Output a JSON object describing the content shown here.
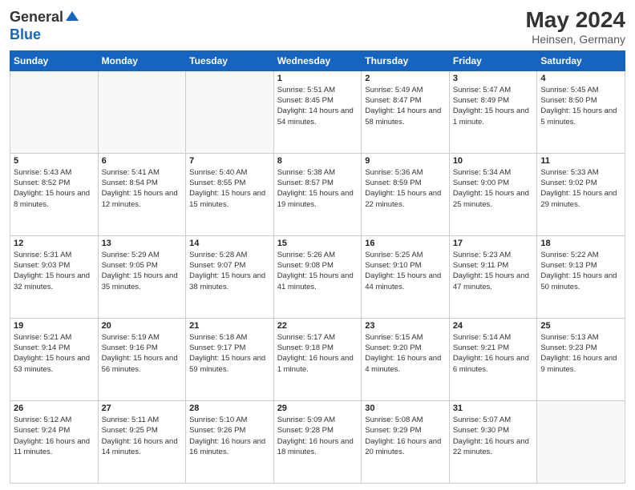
{
  "header": {
    "logo_general": "General",
    "logo_blue": "Blue",
    "month_title": "May 2024",
    "location": "Heinsen, Germany"
  },
  "weekdays": [
    "Sunday",
    "Monday",
    "Tuesday",
    "Wednesday",
    "Thursday",
    "Friday",
    "Saturday"
  ],
  "weeks": [
    [
      {
        "day": "",
        "sunrise": "",
        "sunset": "",
        "daylight": ""
      },
      {
        "day": "",
        "sunrise": "",
        "sunset": "",
        "daylight": ""
      },
      {
        "day": "",
        "sunrise": "",
        "sunset": "",
        "daylight": ""
      },
      {
        "day": "1",
        "sunrise": "Sunrise: 5:51 AM",
        "sunset": "Sunset: 8:45 PM",
        "daylight": "Daylight: 14 hours and 54 minutes."
      },
      {
        "day": "2",
        "sunrise": "Sunrise: 5:49 AM",
        "sunset": "Sunset: 8:47 PM",
        "daylight": "Daylight: 14 hours and 58 minutes."
      },
      {
        "day": "3",
        "sunrise": "Sunrise: 5:47 AM",
        "sunset": "Sunset: 8:49 PM",
        "daylight": "Daylight: 15 hours and 1 minute."
      },
      {
        "day": "4",
        "sunrise": "Sunrise: 5:45 AM",
        "sunset": "Sunset: 8:50 PM",
        "daylight": "Daylight: 15 hours and 5 minutes."
      }
    ],
    [
      {
        "day": "5",
        "sunrise": "Sunrise: 5:43 AM",
        "sunset": "Sunset: 8:52 PM",
        "daylight": "Daylight: 15 hours and 8 minutes."
      },
      {
        "day": "6",
        "sunrise": "Sunrise: 5:41 AM",
        "sunset": "Sunset: 8:54 PM",
        "daylight": "Daylight: 15 hours and 12 minutes."
      },
      {
        "day": "7",
        "sunrise": "Sunrise: 5:40 AM",
        "sunset": "Sunset: 8:55 PM",
        "daylight": "Daylight: 15 hours and 15 minutes."
      },
      {
        "day": "8",
        "sunrise": "Sunrise: 5:38 AM",
        "sunset": "Sunset: 8:57 PM",
        "daylight": "Daylight: 15 hours and 19 minutes."
      },
      {
        "day": "9",
        "sunrise": "Sunrise: 5:36 AM",
        "sunset": "Sunset: 8:59 PM",
        "daylight": "Daylight: 15 hours and 22 minutes."
      },
      {
        "day": "10",
        "sunrise": "Sunrise: 5:34 AM",
        "sunset": "Sunset: 9:00 PM",
        "daylight": "Daylight: 15 hours and 25 minutes."
      },
      {
        "day": "11",
        "sunrise": "Sunrise: 5:33 AM",
        "sunset": "Sunset: 9:02 PM",
        "daylight": "Daylight: 15 hours and 29 minutes."
      }
    ],
    [
      {
        "day": "12",
        "sunrise": "Sunrise: 5:31 AM",
        "sunset": "Sunset: 9:03 PM",
        "daylight": "Daylight: 15 hours and 32 minutes."
      },
      {
        "day": "13",
        "sunrise": "Sunrise: 5:29 AM",
        "sunset": "Sunset: 9:05 PM",
        "daylight": "Daylight: 15 hours and 35 minutes."
      },
      {
        "day": "14",
        "sunrise": "Sunrise: 5:28 AM",
        "sunset": "Sunset: 9:07 PM",
        "daylight": "Daylight: 15 hours and 38 minutes."
      },
      {
        "day": "15",
        "sunrise": "Sunrise: 5:26 AM",
        "sunset": "Sunset: 9:08 PM",
        "daylight": "Daylight: 15 hours and 41 minutes."
      },
      {
        "day": "16",
        "sunrise": "Sunrise: 5:25 AM",
        "sunset": "Sunset: 9:10 PM",
        "daylight": "Daylight: 15 hours and 44 minutes."
      },
      {
        "day": "17",
        "sunrise": "Sunrise: 5:23 AM",
        "sunset": "Sunset: 9:11 PM",
        "daylight": "Daylight: 15 hours and 47 minutes."
      },
      {
        "day": "18",
        "sunrise": "Sunrise: 5:22 AM",
        "sunset": "Sunset: 9:13 PM",
        "daylight": "Daylight: 15 hours and 50 minutes."
      }
    ],
    [
      {
        "day": "19",
        "sunrise": "Sunrise: 5:21 AM",
        "sunset": "Sunset: 9:14 PM",
        "daylight": "Daylight: 15 hours and 53 minutes."
      },
      {
        "day": "20",
        "sunrise": "Sunrise: 5:19 AM",
        "sunset": "Sunset: 9:16 PM",
        "daylight": "Daylight: 15 hours and 56 minutes."
      },
      {
        "day": "21",
        "sunrise": "Sunrise: 5:18 AM",
        "sunset": "Sunset: 9:17 PM",
        "daylight": "Daylight: 15 hours and 59 minutes."
      },
      {
        "day": "22",
        "sunrise": "Sunrise: 5:17 AM",
        "sunset": "Sunset: 9:18 PM",
        "daylight": "Daylight: 16 hours and 1 minute."
      },
      {
        "day": "23",
        "sunrise": "Sunrise: 5:15 AM",
        "sunset": "Sunset: 9:20 PM",
        "daylight": "Daylight: 16 hours and 4 minutes."
      },
      {
        "day": "24",
        "sunrise": "Sunrise: 5:14 AM",
        "sunset": "Sunset: 9:21 PM",
        "daylight": "Daylight: 16 hours and 6 minutes."
      },
      {
        "day": "25",
        "sunrise": "Sunrise: 5:13 AM",
        "sunset": "Sunset: 9:23 PM",
        "daylight": "Daylight: 16 hours and 9 minutes."
      }
    ],
    [
      {
        "day": "26",
        "sunrise": "Sunrise: 5:12 AM",
        "sunset": "Sunset: 9:24 PM",
        "daylight": "Daylight: 16 hours and 11 minutes."
      },
      {
        "day": "27",
        "sunrise": "Sunrise: 5:11 AM",
        "sunset": "Sunset: 9:25 PM",
        "daylight": "Daylight: 16 hours and 14 minutes."
      },
      {
        "day": "28",
        "sunrise": "Sunrise: 5:10 AM",
        "sunset": "Sunset: 9:26 PM",
        "daylight": "Daylight: 16 hours and 16 minutes."
      },
      {
        "day": "29",
        "sunrise": "Sunrise: 5:09 AM",
        "sunset": "Sunset: 9:28 PM",
        "daylight": "Daylight: 16 hours and 18 minutes."
      },
      {
        "day": "30",
        "sunrise": "Sunrise: 5:08 AM",
        "sunset": "Sunset: 9:29 PM",
        "daylight": "Daylight: 16 hours and 20 minutes."
      },
      {
        "day": "31",
        "sunrise": "Sunrise: 5:07 AM",
        "sunset": "Sunset: 9:30 PM",
        "daylight": "Daylight: 16 hours and 22 minutes."
      },
      {
        "day": "",
        "sunrise": "",
        "sunset": "",
        "daylight": ""
      }
    ]
  ]
}
